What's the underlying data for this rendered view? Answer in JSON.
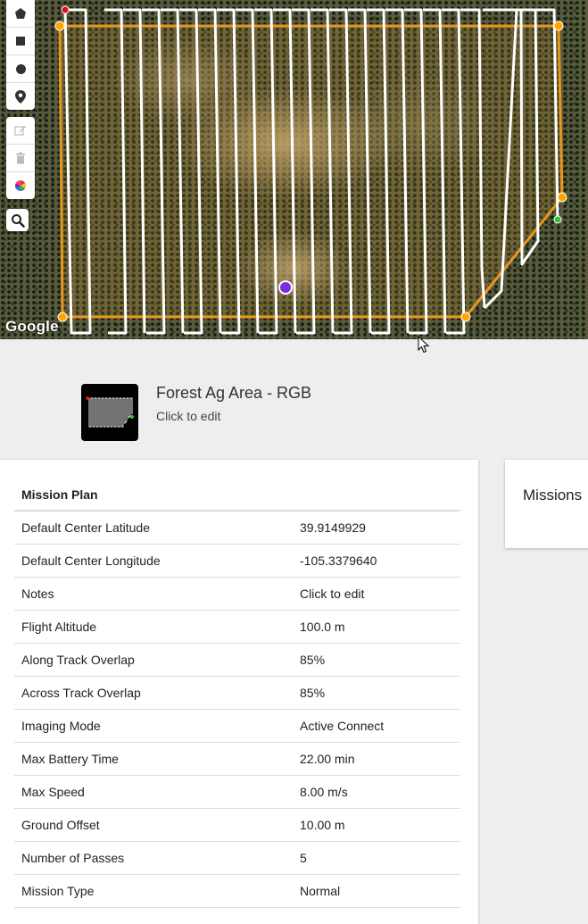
{
  "map": {
    "attribution": "Google",
    "draw_tools": [
      "polygon-icon",
      "rectangle-icon",
      "circle-icon",
      "marker-icon"
    ],
    "edit_tools": [
      "edit-icon",
      "trash-icon",
      "color-icon"
    ],
    "search_icon": "search-icon",
    "colors": {
      "flight_path": "#ffffff",
      "boundary": "#e8961e",
      "vertex": "#ffa500",
      "start_point": "#dd1111",
      "end_point": "#3bbf3b",
      "center_point": "#7b2fe0"
    }
  },
  "header": {
    "title": "Forest Ag Area - RGB",
    "subtitle": "Click to edit"
  },
  "mission_plan": {
    "heading": "Mission Plan",
    "rows": [
      {
        "label": "Default Center Latitude",
        "value": "39.9149929"
      },
      {
        "label": "Default Center Longitude",
        "value": "-105.3379640"
      },
      {
        "label": "Notes",
        "value": "Click to edit"
      },
      {
        "label": "Flight Altitude",
        "value": "100.0 m"
      },
      {
        "label": "Along Track Overlap",
        "value": "85%"
      },
      {
        "label": "Across Track Overlap",
        "value": "85%"
      },
      {
        "label": "Imaging Mode",
        "value": "Active Connect"
      },
      {
        "label": "Max Battery Time",
        "value": "22.00 min"
      },
      {
        "label": "Max Speed",
        "value": "8.00 m/s"
      },
      {
        "label": "Ground Offset",
        "value": "10.00 m"
      },
      {
        "label": "Number of Passes",
        "value": "5"
      },
      {
        "label": "Mission Type",
        "value": "Normal"
      }
    ]
  },
  "missions": {
    "heading": "Missions"
  }
}
